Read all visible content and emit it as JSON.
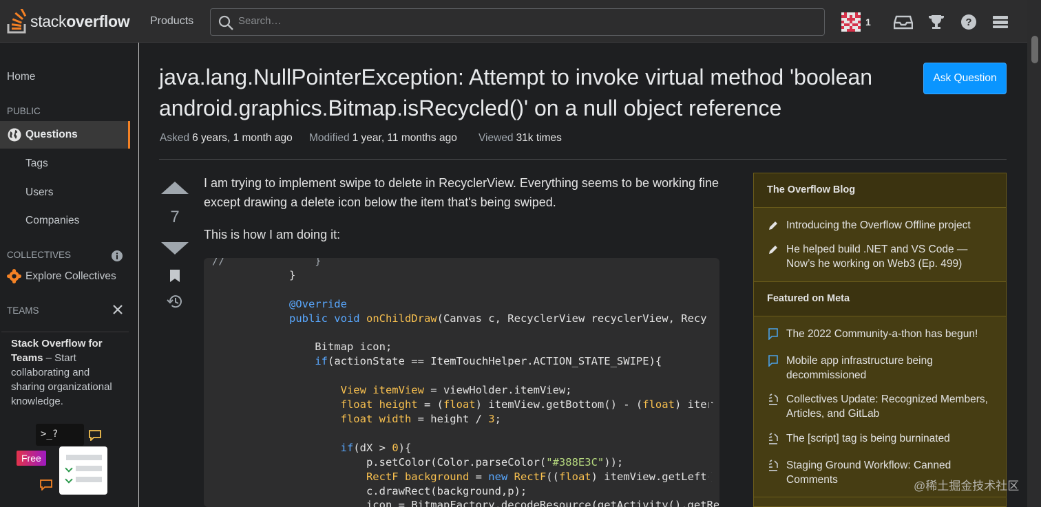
{
  "header": {
    "logo_light": "stack",
    "logo_bold": "overflow",
    "products": "Products",
    "search_placeholder": "Search…",
    "reputation": "1"
  },
  "sidebar": {
    "home": "Home",
    "public_heading": "PUBLIC",
    "questions": "Questions",
    "tags": "Tags",
    "users": "Users",
    "companies": "Companies",
    "collectives_heading": "COLLECTIVES",
    "explore_collectives": "Explore Collectives",
    "teams_heading": "TEAMS",
    "teams_title": "Stack Overflow for Teams",
    "teams_desc": " – Start collaborating and sharing organizational knowledge.",
    "free_badge": "Free",
    "prompt_text": ">_?"
  },
  "question": {
    "title": "java.lang.NullPointerException: Attempt to invoke virtual method 'boolean android.graphics.Bitmap.isRecycled()' on a null object reference",
    "ask_button": "Ask Question",
    "asked_label": "Asked",
    "asked_value": "6 years, 1 month ago",
    "modified_label": "Modified",
    "modified_value": "1 year, 11 months ago",
    "viewed_label": "Viewed",
    "viewed_value": "31k times",
    "score": "7",
    "paragraph1": "I am trying to implement swipe to delete in RecyclerView. Everything seems to be working fine except drawing a delete icon below the item that's being swiped.",
    "paragraph2": "This is how I am doing it:"
  },
  "code_lines": [
    "//              }",
    "            }",
    "",
    "            @Override",
    "            public void onChildDraw(Canvas c, RecyclerView recyclerView, Recy",
    "",
    "                Bitmap icon;",
    "                if(actionState == ItemTouchHelper.ACTION_STATE_SWIPE){",
    "",
    "                    View itemView = viewHolder.itemView;",
    "                    float height = (float) itemView.getBottom() - (float) iter",
    "                    float width = height / 3;",
    "",
    "                    if(dX > 0){",
    "                        p.setColor(Color.parseColor(\"#388E3C\"));",
    "                        RectF background = new RectF((float) itemView.getLeft(",
    "                        c.drawRect(background,p);",
    "                        icon = BitmapFactory.decodeResource(getActivity().getRes"
  ],
  "blog": {
    "overflow_heading": "The Overflow Blog",
    "overflow_items": [
      "Introducing the Overflow Offline project",
      "He helped build .NET and VS Code — Now’s he working on Web3 (Ep. 499)"
    ],
    "meta_heading": "Featured on Meta",
    "meta_items": [
      "The 2022 Community-a-thon has begun!",
      "Mobile app infrastructure being decommissioned",
      "Collectives Update: Recognized Members, Articles, and GitLab",
      "The [script] tag is being burninated",
      "Staging Ground Workflow: Canned Comments"
    ]
  },
  "watermark": "@稀土掘金技术社区",
  "colors": {
    "accent": "#f48225",
    "primary_button": "#0a95ff",
    "blog_bg": "#463d13",
    "page_bg": "#1e1f21"
  }
}
